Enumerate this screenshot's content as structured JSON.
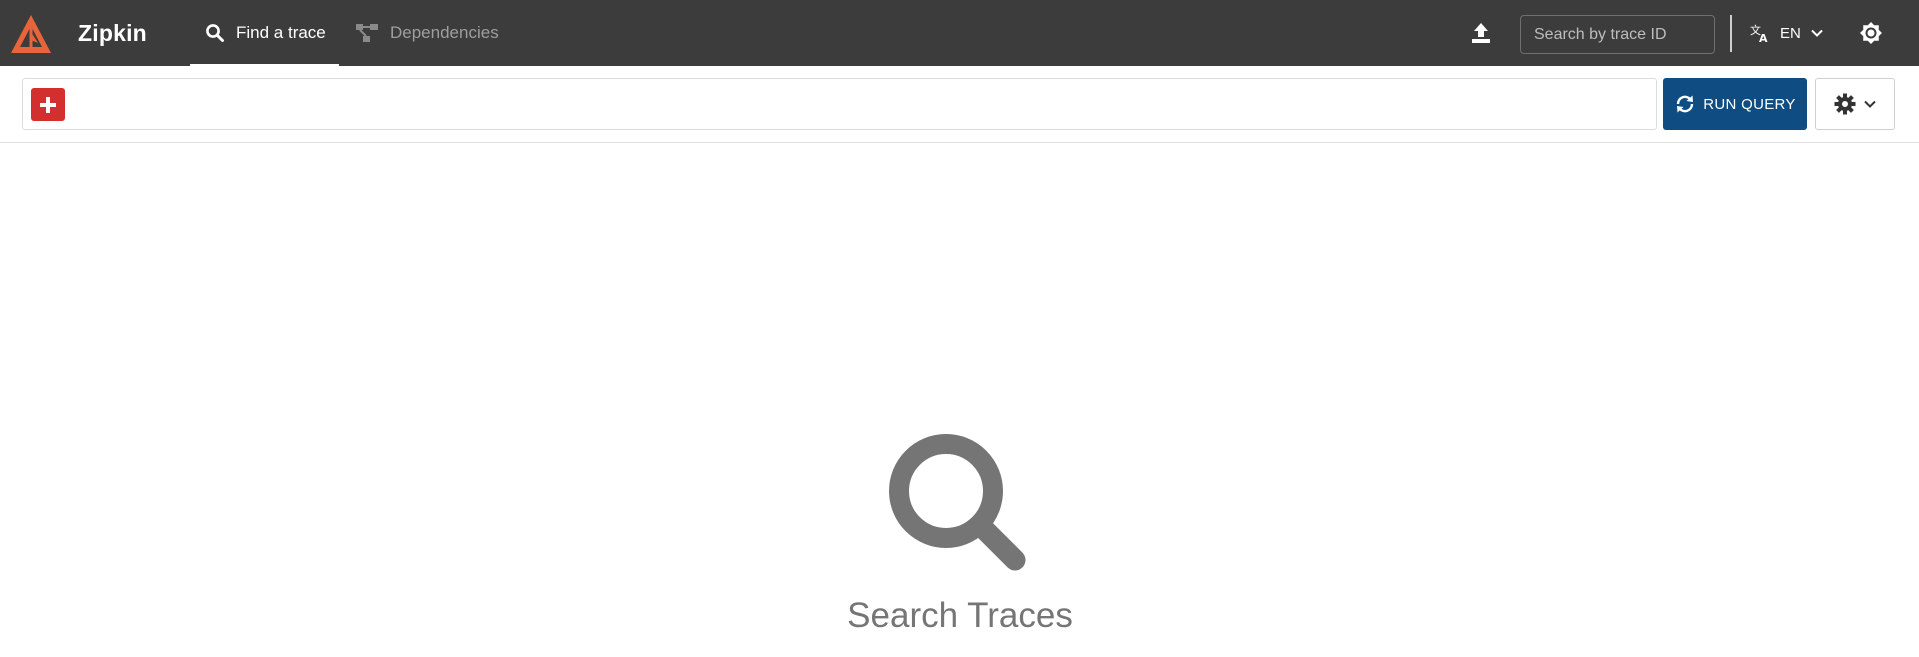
{
  "header": {
    "brand": "Zipkin",
    "tabs": [
      {
        "label": "Find a trace",
        "icon": "search-icon",
        "active": true
      },
      {
        "label": "Dependencies",
        "icon": "dependencies-icon",
        "active": false
      }
    ],
    "trace_search": {
      "placeholder": "Search by trace ID",
      "value": ""
    },
    "language": {
      "code": "EN",
      "icon": "translate-icon"
    },
    "icons": {
      "upload": "upload-icon",
      "theme": "brightness-icon"
    }
  },
  "query": {
    "add_icon": "plus-icon",
    "run_label": "RUN QUERY",
    "run_icon": "sync-icon",
    "settings_icon": "gear-icon"
  },
  "empty_state": {
    "icon": "search-icon",
    "text": "Search Traces"
  },
  "colors": {
    "header_bg": "#3c3c3c",
    "logo_orange": "#e8643a",
    "add_button": "#d32f2f",
    "run_button": "#0f4c81",
    "empty_gray": "#757575"
  }
}
